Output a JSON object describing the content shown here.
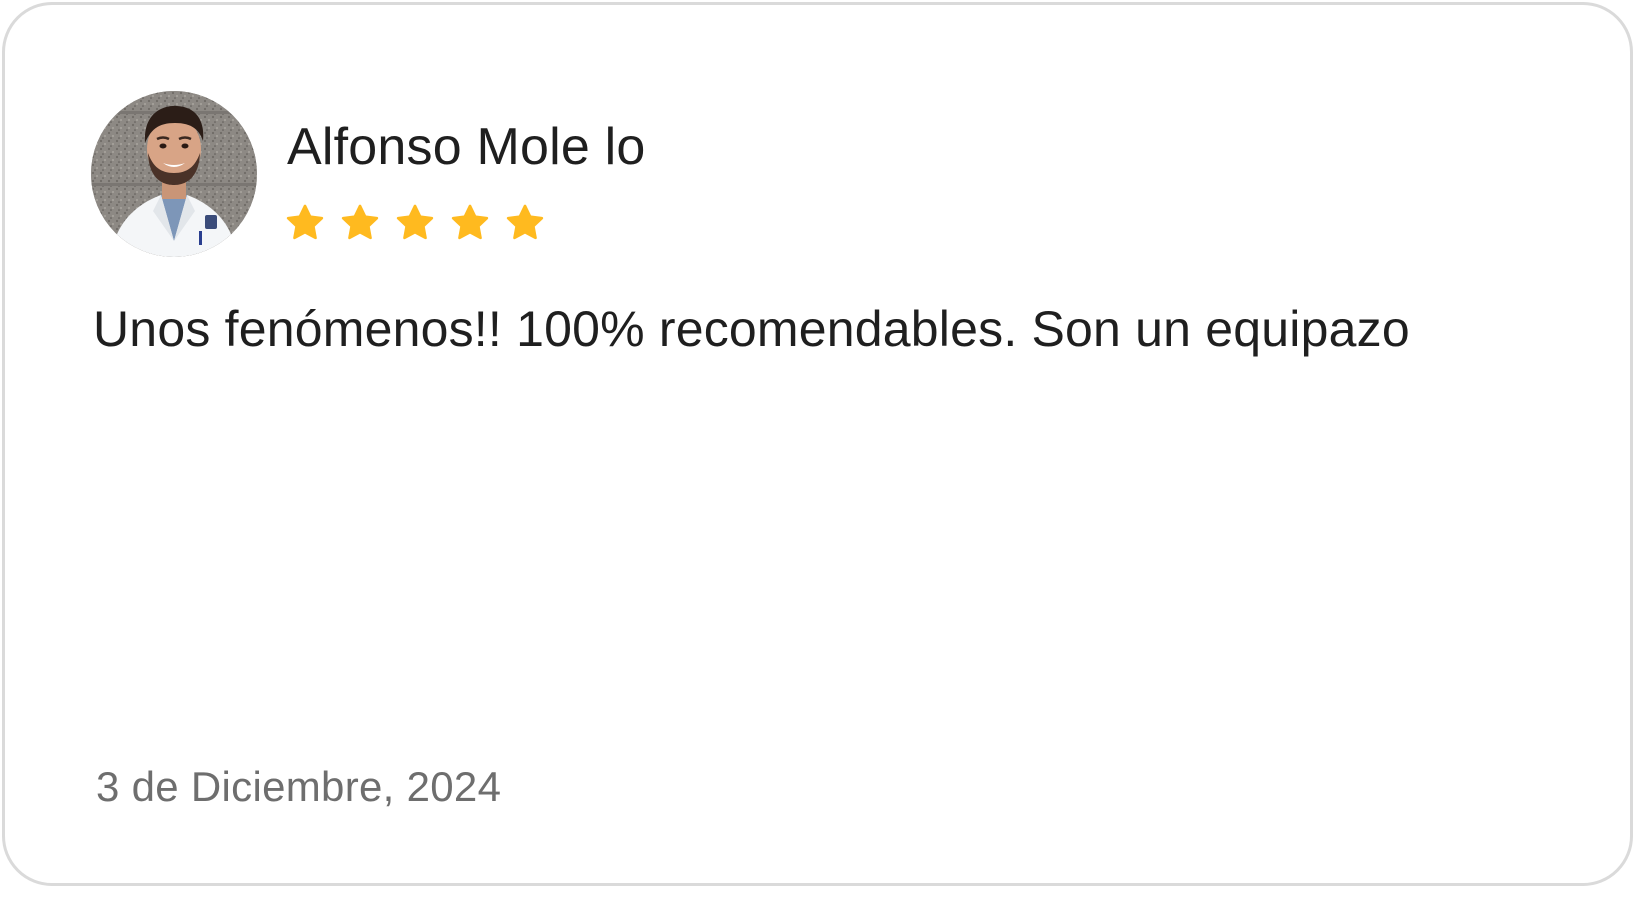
{
  "review": {
    "author_name": "Alfonso Mole lo",
    "rating": 5,
    "rating_max": 5,
    "text": "Unos fenómenos!! 100% recomendables. Son un equipazo",
    "date": "3 de Diciembre, 2024"
  },
  "icons": {
    "star": "star-icon",
    "avatar": "person-avatar"
  },
  "colors": {
    "star": "#FFBA1F",
    "text": "#1F1F1F",
    "date": "#6E6E6E",
    "border": "#DADADA"
  }
}
